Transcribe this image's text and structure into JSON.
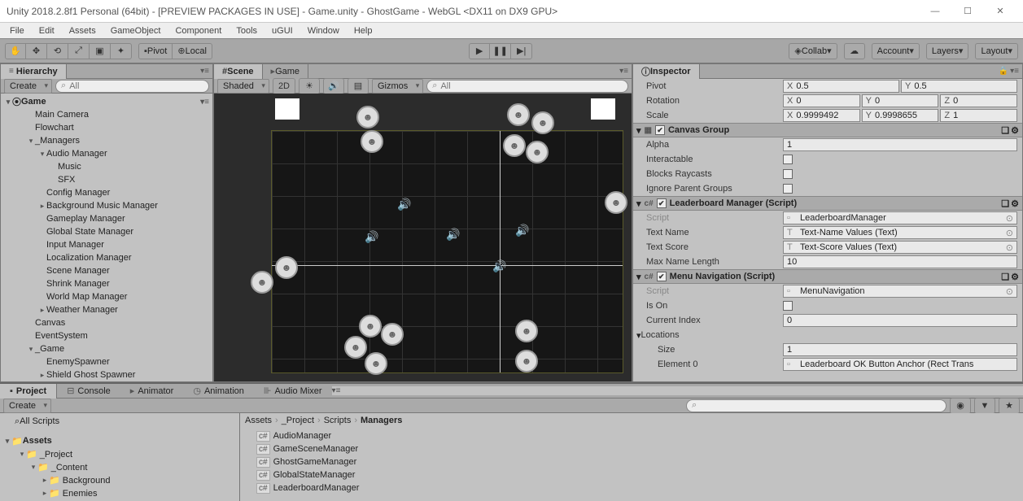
{
  "window": {
    "title": "Unity 2018.2.8f1 Personal (64bit) - [PREVIEW PACKAGES IN USE] - Game.unity - GhostGame - WebGL <DX11 on DX9 GPU>"
  },
  "menu": [
    "File",
    "Edit",
    "Assets",
    "GameObject",
    "Component",
    "Tools",
    "uGUI",
    "Window",
    "Help"
  ],
  "toolbar": {
    "pivot": "Pivot",
    "local": "Local",
    "collab": "Collab",
    "account": "Account",
    "layers": "Layers",
    "layout": "Layout"
  },
  "hierarchy": {
    "title": "Hierarchy",
    "create": "Create",
    "searchPlaceholder": "All",
    "root": "Game",
    "items": [
      {
        "t": "Main Camera",
        "d": 2
      },
      {
        "t": "Flowchart",
        "d": 2
      },
      {
        "t": "_Managers",
        "d": 2,
        "exp": true
      },
      {
        "t": "Audio Manager",
        "d": 3,
        "exp": true
      },
      {
        "t": "Music",
        "d": 4
      },
      {
        "t": "SFX",
        "d": 4
      },
      {
        "t": "Config Manager",
        "d": 3
      },
      {
        "t": "Background Music Manager",
        "d": 3,
        "arr": true
      },
      {
        "t": "Gameplay Manager",
        "d": 3
      },
      {
        "t": "Global State Manager",
        "d": 3
      },
      {
        "t": "Input Manager",
        "d": 3
      },
      {
        "t": "Localization Manager",
        "d": 3
      },
      {
        "t": "Scene Manager",
        "d": 3
      },
      {
        "t": "Shrink Manager",
        "d": 3
      },
      {
        "t": "World Map Manager",
        "d": 3
      },
      {
        "t": "Weather Manager",
        "d": 3,
        "arr": true
      },
      {
        "t": "Canvas",
        "d": 2
      },
      {
        "t": "EventSystem",
        "d": 2
      },
      {
        "t": "_Game",
        "d": 2,
        "exp": true
      },
      {
        "t": "EnemySpawner",
        "d": 3
      },
      {
        "t": "Shield Ghost Spawner",
        "d": 3,
        "arr": true
      }
    ]
  },
  "scene": {
    "tab1": "Scene",
    "tab2": "Game",
    "shaded": "Shaded",
    "two_d": "2D",
    "gizmos": "Gizmos",
    "searchPlaceholder": "All"
  },
  "inspector": {
    "title": "Inspector",
    "transform": {
      "pivot": {
        "x": "0.5",
        "y": "0.5"
      },
      "rotation": {
        "x": "0",
        "y": "0",
        "z": "0"
      },
      "scale": {
        "x": "0.9999492",
        "y": "0.9998655",
        "z": "1"
      }
    },
    "canvasGroup": {
      "title": "Canvas Group",
      "alpha": "1",
      "interactable": "Interactable",
      "blocks": "Blocks Raycasts",
      "ignore": "Ignore Parent Groups"
    },
    "leaderboard": {
      "title": "Leaderboard Manager (Script)",
      "script": "LeaderboardManager",
      "textName": "Text-Name Values (Text)",
      "textScore": "Text-Score Values (Text)",
      "maxLen": "10",
      "labels": {
        "script": "Script",
        "textName": "Text Name",
        "textScore": "Text Score",
        "maxName": "Max Name Length"
      }
    },
    "menuNav": {
      "title": "Menu Navigation (Script)",
      "script": "MenuNavigation",
      "isOn": "Is On",
      "curIdx": "Current Index",
      "curIdxVal": "0",
      "locations": "Locations",
      "size": "Size",
      "sizeVal": "1",
      "el0": "Element 0",
      "el0Val": "Leaderboard OK Button Anchor (Rect Trans"
    }
  },
  "project": {
    "tabs": [
      "Project",
      "Console",
      "Animator",
      "Animation",
      "Audio Mixer"
    ],
    "create": "Create",
    "searchPlaceholder": "",
    "allScripts": "All Scripts",
    "assets": "Assets",
    "tree": [
      {
        "t": "_Project",
        "d": 1,
        "exp": true
      },
      {
        "t": "_Content",
        "d": 2,
        "exp": true
      },
      {
        "t": "Background",
        "d": 3
      },
      {
        "t": "Enemies",
        "d": 3
      }
    ],
    "breadcrumb": [
      "Assets",
      "_Project",
      "Scripts",
      "Managers"
    ],
    "files": [
      "AudioManager",
      "GameSceneManager",
      "GhostGameManager",
      "GlobalStateManager",
      "LeaderboardManager"
    ]
  }
}
